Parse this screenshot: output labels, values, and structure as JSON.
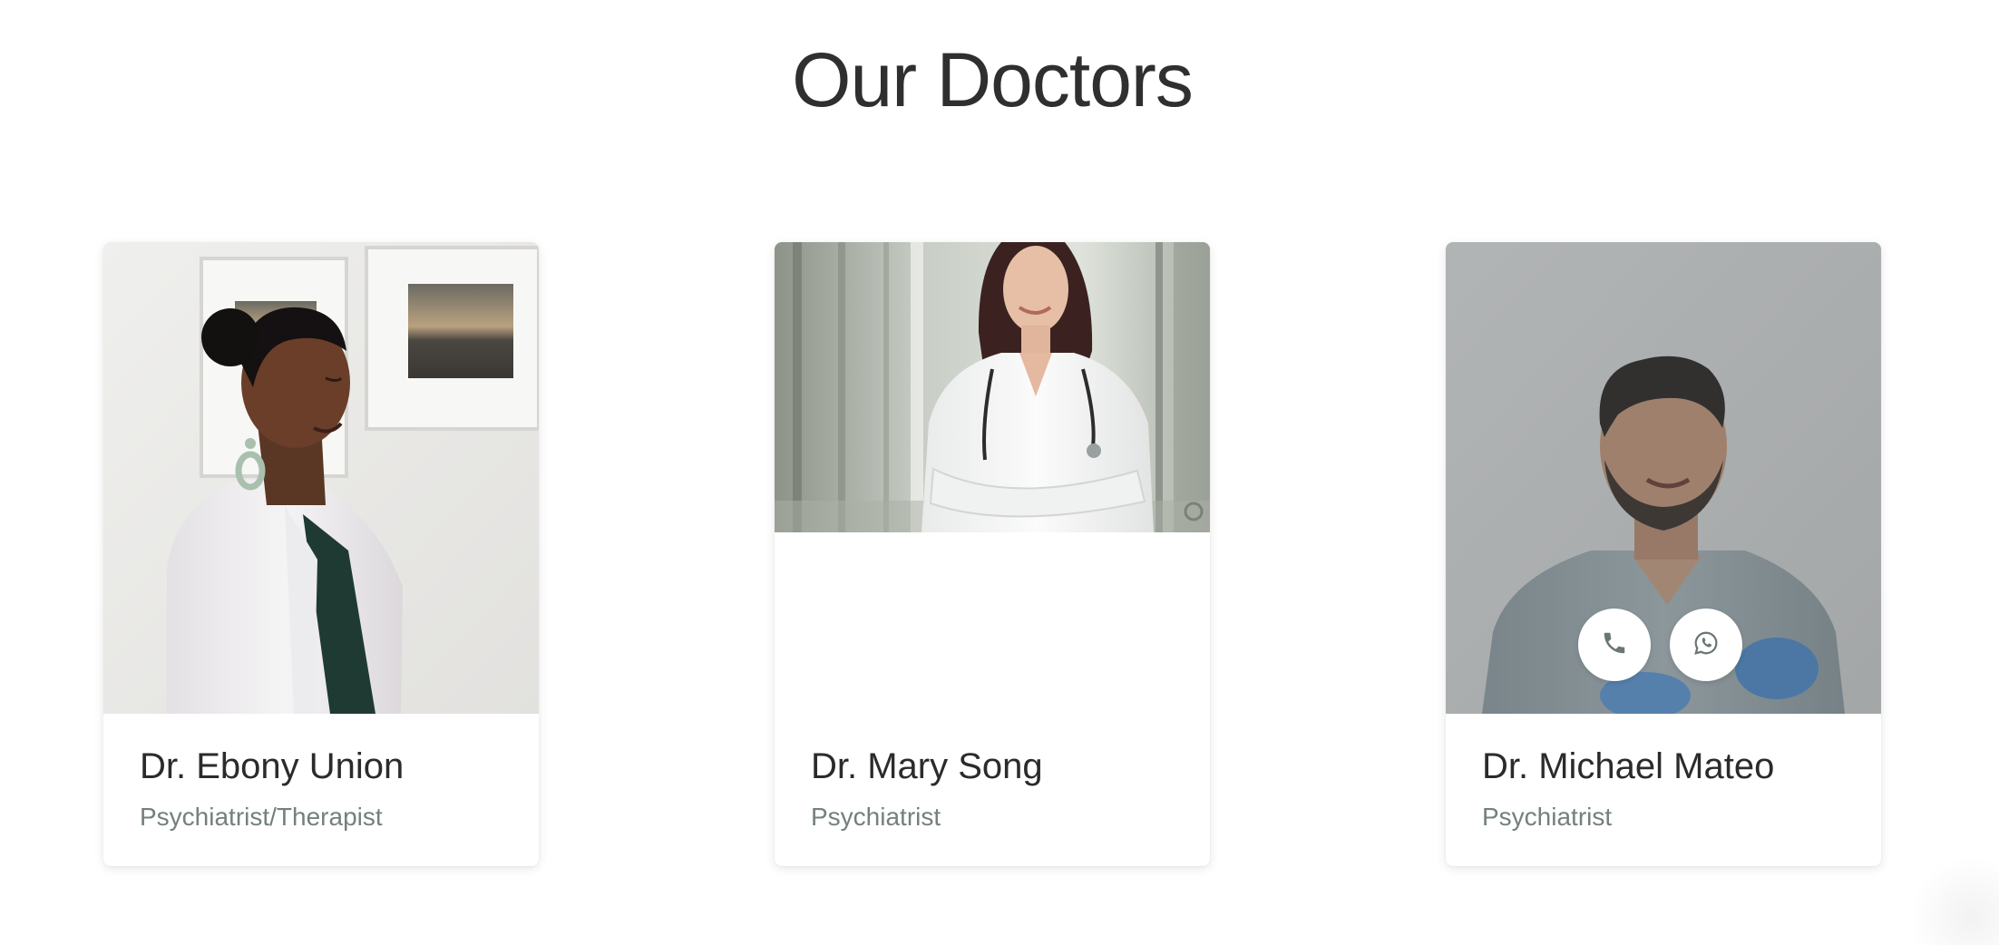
{
  "section": {
    "title": "Our Doctors"
  },
  "doctors": [
    {
      "name": "Dr. Ebony Union",
      "role": "Psychiatrist/Therapist"
    },
    {
      "name": "Dr. Mary Song",
      "role": "Psychiatrist"
    },
    {
      "name": "Dr. Michael Mateo",
      "role": "Psychiatrist",
      "contact_icons": [
        "phone-icon",
        "whatsapp-icon"
      ]
    }
  ],
  "colors": {
    "title": "#2f2f2f",
    "name": "#2b2b2b",
    "role": "#74807c",
    "icon": "#6b7772"
  }
}
